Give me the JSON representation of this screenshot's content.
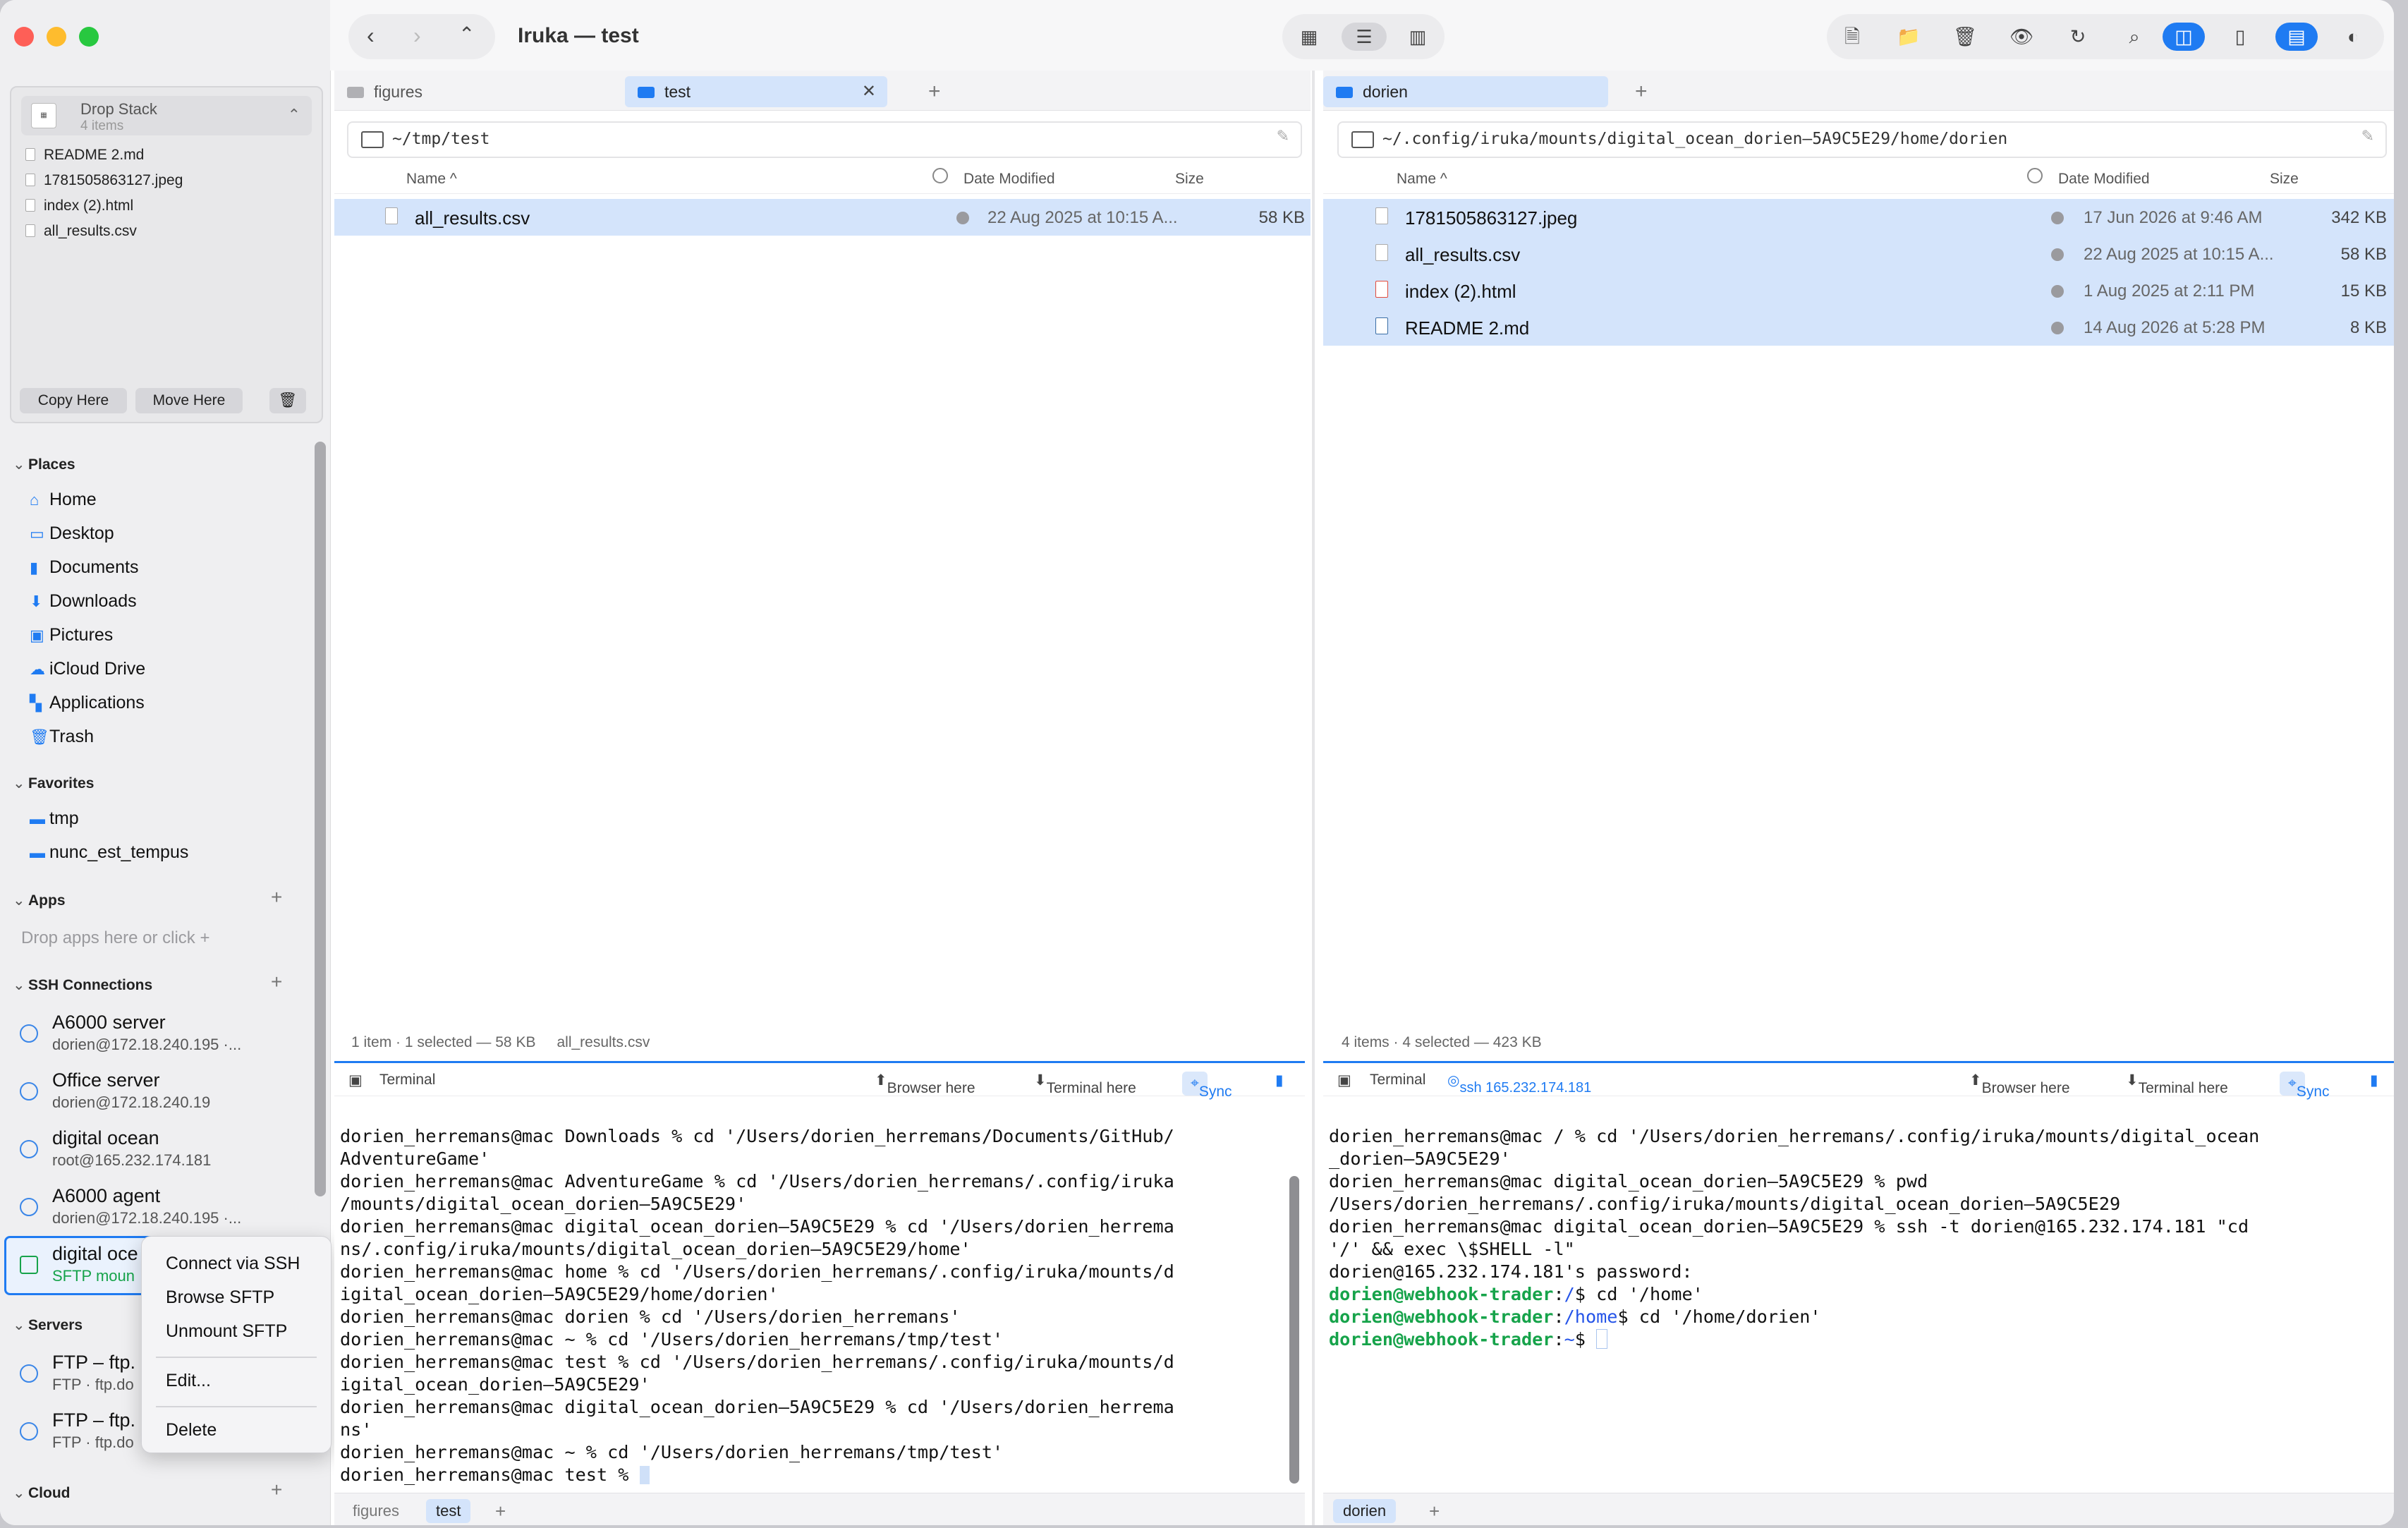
{
  "window": {
    "title": "Iruka — test"
  },
  "drop_stack": {
    "title": "Drop Stack",
    "count": "4 items",
    "files": [
      "README 2.md",
      "1781505863127.jpeg",
      "index (2).html",
      "all_results.csv"
    ],
    "copy_label": "Copy Here",
    "move_label": "Move Here"
  },
  "sidebar": {
    "places_label": "Places",
    "places": [
      "Home",
      "Desktop",
      "Documents",
      "Downloads",
      "Pictures",
      "iCloud Drive",
      "Applications",
      "Trash"
    ],
    "favorites_label": "Favorites",
    "favorites": [
      "tmp",
      "nunc_est_tempus"
    ],
    "apps_label": "Apps",
    "apps_hint": "Drop apps here or click +",
    "ssh_label": "SSH Connections",
    "ssh": [
      {
        "name": "A6000 server",
        "sub": "dorien@172.18.240.195 ·..."
      },
      {
        "name": "Office server",
        "sub": "dorien@172.18.240.19"
      },
      {
        "name": "digital ocean",
        "sub": "root@165.232.174.181"
      },
      {
        "name": "A6000 agent",
        "sub": "dorien@172.18.240.195 ·..."
      },
      {
        "name": "digital oce",
        "sub": "SFTP moun"
      }
    ],
    "servers_label": "Servers",
    "servers": [
      {
        "name": "FTP – ftp.",
        "sub": "FTP · ftp.do"
      },
      {
        "name": "FTP – ftp.",
        "sub": "FTP · ftp.do"
      }
    ],
    "cloud_label": "Cloud"
  },
  "context_menu": [
    "Connect via SSH",
    "Browse SFTP",
    "Unmount SFTP",
    "Edit...",
    "Delete"
  ],
  "left_pane": {
    "tabs": [
      "figures",
      "test"
    ],
    "path": "~/tmp/test",
    "columns": {
      "name": "Name ^",
      "date": "Date Modified",
      "size": "Size"
    },
    "rows": [
      {
        "name": "all_results.csv",
        "date": "22 Aug 2025 at 10:15 A...",
        "size": "58 KB"
      }
    ],
    "status": "1 item · 1 selected — 58 KB",
    "status_file": "all_results.csv"
  },
  "right_pane": {
    "tabs": [
      "dorien"
    ],
    "path": "~/.config/iruka/mounts/digital_ocean_dorien–5A9C5E29/home/dorien",
    "columns": {
      "name": "Name ^",
      "date": "Date Modified",
      "size": "Size"
    },
    "rows": [
      {
        "name": "1781505863127.jpeg",
        "date": "17 Jun 2026 at 9:46 AM",
        "size": "342 KB"
      },
      {
        "name": "all_results.csv",
        "date": "22 Aug 2025 at 10:15 A...",
        "size": "58 KB"
      },
      {
        "name": "index (2).html",
        "date": "1 Aug 2025 at 2:11 PM",
        "size": "15 KB"
      },
      {
        "name": "README 2.md",
        "date": "14 Aug 2026 at 5:28 PM",
        "size": "8 KB"
      }
    ],
    "status": "4 items · 4 selected — 423 KB"
  },
  "terminal_left": {
    "label": "Terminal",
    "browser_here": "Browser here",
    "terminal_here": "Terminal here",
    "sync": "Sync",
    "lines": [
      "dorien_herremans@mac Downloads % cd '/Users/dorien_herremans/Documents/GitHub/",
      "AdventureGame'",
      "dorien_herremans@mac AdventureGame % cd '/Users/dorien_herremans/.config/iruka",
      "/mounts/digital_ocean_dorien–5A9C5E29'",
      "dorien_herremans@mac digital_ocean_dorien–5A9C5E29 % cd '/Users/dorien_herrema",
      "ns/.config/iruka/mounts/digital_ocean_dorien–5A9C5E29/home'",
      "dorien_herremans@mac home % cd '/Users/dorien_herremans/.config/iruka/mounts/d",
      "igital_ocean_dorien–5A9C5E29/home/dorien'",
      "dorien_herremans@mac dorien % cd '/Users/dorien_herremans'",
      "dorien_herremans@mac ~ % cd '/Users/dorien_herremans/tmp/test'",
      "dorien_herremans@mac test % cd '/Users/dorien_herremans/.config/iruka/mounts/d",
      "igital_ocean_dorien–5A9C5E29'",
      "dorien_herremans@mac digital_ocean_dorien–5A9C5E29 % cd '/Users/dorien_herrema",
      "ns'",
      "dorien_herremans@mac ~ % cd '/Users/dorien_herremans/tmp/test'",
      "dorien_herremans@mac test % "
    ],
    "tabs": [
      "figures",
      "test"
    ]
  },
  "terminal_right": {
    "label": "Terminal",
    "ssh_badge": "ssh 165.232.174.181",
    "browser_here": "Browser here",
    "terminal_here": "Terminal here",
    "sync": "Sync",
    "lines": [
      "dorien_herremans@mac / % cd '/Users/dorien_herremans/.config/iruka/mounts/digital_ocean",
      "_dorien–5A9C5E29'",
      "dorien_herremans@mac digital_ocean_dorien–5A9C5E29 % pwd",
      "/Users/dorien_herremans/.config/iruka/mounts/digital_ocean_dorien–5A9C5E29",
      "dorien_herremans@mac digital_ocean_dorien–5A9C5E29 % ssh -t dorien@165.232.174.181 \"cd",
      "'/' && exec \\$SHELL -l\"",
      "dorien@165.232.174.181's password:"
    ],
    "prompt_user": "dorien@webhook-trader",
    "prompt_lines": [
      {
        "path": "/",
        "cmd": "$ cd '/home'"
      },
      {
        "path": "/home",
        "cmd": "$ cd '/home/dorien'"
      },
      {
        "path": "~",
        "cmd": "$ "
      }
    ],
    "tabs": [
      "dorien"
    ]
  },
  "colors": {
    "accent": "#1f7bf2",
    "selection": "#d4e4fb",
    "prompt_green": "#16a34a"
  }
}
